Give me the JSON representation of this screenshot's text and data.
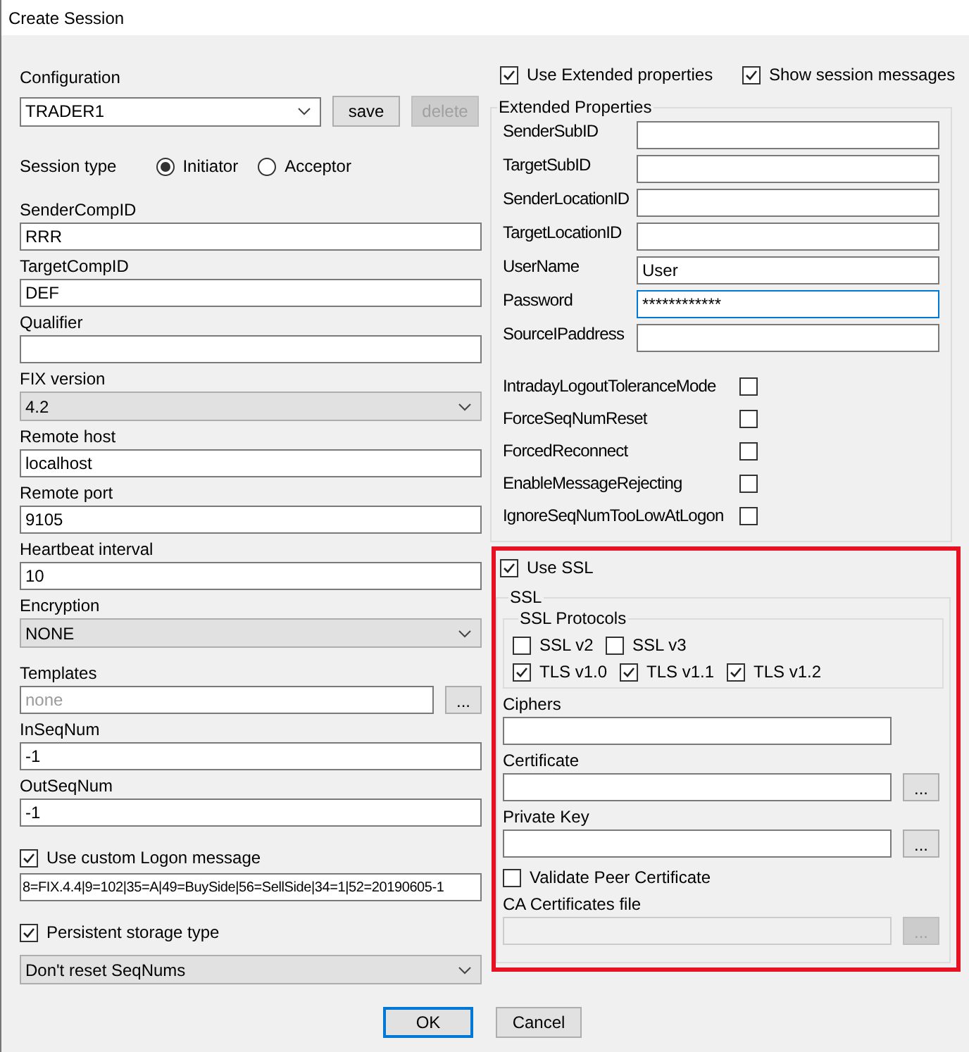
{
  "window": {
    "title": "Create Session"
  },
  "configuration": {
    "label": "Configuration",
    "value": "TRADER1",
    "buttons": [
      {
        "label": "save",
        "disabled": false
      },
      {
        "label": "delete",
        "disabled": true
      }
    ]
  },
  "session_type": {
    "label": "Session type",
    "options": [
      {
        "label": "Initiator",
        "selected": true
      },
      {
        "label": "Acceptor",
        "selected": false
      }
    ]
  },
  "fields": [
    {
      "kind": "text",
      "label": "SenderCompID",
      "value": "RRR"
    },
    {
      "kind": "text",
      "label": "TargetCompID",
      "value": "DEF"
    },
    {
      "kind": "text",
      "label": "Qualifier"
    },
    {
      "kind": "select",
      "label": "FIX version",
      "value": "4.2"
    },
    {
      "kind": "text",
      "label": "Remote host",
      "value": "localhost"
    },
    {
      "kind": "text",
      "label": "Remote port",
      "value": "9105"
    },
    {
      "kind": "text",
      "label": "Heartbeat interval",
      "value": "10"
    },
    {
      "kind": "select",
      "label": "Encryption",
      "value": "NONE"
    },
    {
      "kind": "browse",
      "label": "Templates",
      "placeholder": "none",
      "button": "..."
    },
    {
      "kind": "text",
      "label": "InSeqNum",
      "value": "-1"
    },
    {
      "kind": "text",
      "label": "OutSeqNum",
      "value": "-1"
    }
  ],
  "custom_logon": {
    "label": "Use custom Logon message",
    "checked": true,
    "value": "8=FIX.4.4|9=102|35=A|49=BuySide|56=SellSide|34=1|52=20190605-1"
  },
  "persistent_storage": {
    "label": "Persistent storage type",
    "checked": true,
    "value": "Don't reset SeqNums"
  },
  "options": [
    {
      "label": "Use Extended properties",
      "checked": true
    },
    {
      "label": "Show session messages",
      "checked": true
    }
  ],
  "extended_properties": {
    "title": "Extended Properties",
    "fields": [
      {
        "label": "SenderSubID",
        "focused": false
      },
      {
        "label": "TargetSubID",
        "focused": false
      },
      {
        "label": "SenderLocationID",
        "focused": false
      },
      {
        "label": "TargetLocationID",
        "focused": false
      },
      {
        "label": "UserName",
        "value": "User",
        "focused": false
      },
      {
        "label": "Password",
        "value": "************",
        "focused": true
      },
      {
        "label": "SourceIPaddress",
        "focused": false
      }
    ],
    "flags": [
      {
        "label": "IntradayLogoutToleranceMode",
        "checked": false
      },
      {
        "label": "ForceSeqNumReset",
        "checked": false
      },
      {
        "label": "ForcedReconnect",
        "checked": false
      },
      {
        "label": "EnableMessageRejecting",
        "checked": false
      },
      {
        "label": "IgnoreSeqNumTooLowAtLogon",
        "checked": false
      }
    ]
  },
  "ssl": {
    "highlighted": true,
    "use_ssl": {
      "label": "Use SSL",
      "checked": true
    },
    "title": "SSL",
    "protocols": {
      "title": "SSL Protocols",
      "rows": [
        [
          {
            "label": "SSL v2",
            "checked": false
          },
          {
            "label": "SSL v3",
            "checked": false
          }
        ],
        [
          {
            "label": "TLS v1.0",
            "checked": true
          },
          {
            "label": "TLS v1.1",
            "checked": true
          },
          {
            "label": "TLS v1.2",
            "checked": true
          }
        ]
      ]
    },
    "fields": [
      {
        "kind": "text",
        "label": "Ciphers",
        "disabled": false
      },
      {
        "kind": "browse",
        "label": "Certificate",
        "button": "...",
        "disabled": false
      },
      {
        "kind": "browse",
        "label": "Private Key",
        "button": "...",
        "disabled": false
      }
    ],
    "validate": {
      "label": "Validate Peer Certificate",
      "checked": false
    },
    "ca_file": {
      "kind": "browse",
      "label": "CA Certificates file",
      "button": "...",
      "disabled": true
    }
  },
  "buttons": [
    {
      "label": "OK",
      "default": true
    },
    {
      "label": "Cancel",
      "default": false
    }
  ]
}
